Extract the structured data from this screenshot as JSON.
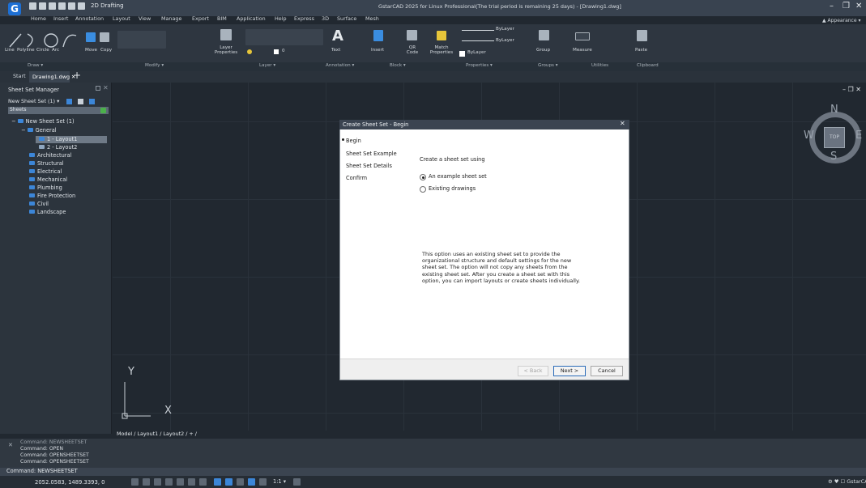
{
  "titlebar": {
    "logo": "G",
    "workspace": "2D Drafting",
    "window_title": "GstarCAD 2025 for Linux Professional(The trial period is remaining 25 days) - [Drawing1.dwg]",
    "controls": [
      "–",
      "❐",
      "✕"
    ],
    "appearance": "▲ Appearance ▾"
  },
  "menu": [
    "Home",
    "Insert",
    "Annotation",
    "Layout",
    "View",
    "Manage",
    "Export",
    "BIM",
    "Application",
    "Help",
    "Express",
    "3D",
    "Surface",
    "Mesh"
  ],
  "ribbon": {
    "tools": [
      "Line",
      "Polyline",
      "Circle",
      "Arc",
      "Move",
      "Copy",
      "Layer Properties",
      "Text",
      "Insert",
      "QR Code",
      "Match Properties",
      "Group",
      "Measure",
      "Paste"
    ],
    "layer_value": "0",
    "bylayer_1": "ByLayer",
    "bylayer_2": "ByLayer",
    "bylayer_3": "ByLayer",
    "groups": [
      "Draw ▾",
      "Modify ▾",
      "Layer ▾",
      "Annotation ▾",
      "Block ▾",
      "Properties ▾",
      "Groups ▾",
      "Utilities",
      "Clipboard"
    ]
  },
  "doc_tabs": {
    "start": "Start",
    "drawing": "Drawing1.dwg ✕",
    "add": "+"
  },
  "sheet_set_manager": {
    "title": "Sheet Set Manager",
    "combo": "New Sheet Set (1) ▾",
    "tab": "Sheets",
    "tree": {
      "root": "New Sheet Set (1)",
      "general": "General",
      "layout1": "1 - Layout1",
      "layout2": "2 - Layout2",
      "categories": [
        "Architectural",
        "Structural",
        "Electrical",
        "Mechanical",
        "Plumbing",
        "Fire Protection",
        "Civil",
        "Landscape"
      ]
    }
  },
  "model_tabs": "Model / Layout1 / Layout2 / + /",
  "viewcube": {
    "face": "TOP",
    "n": "N",
    "s": "S",
    "e": "E",
    "w": "W"
  },
  "ucs": {
    "x": "X",
    "y": "Y"
  },
  "drawing_window_controls": "– ❐ ✕",
  "dialog": {
    "title": "Create Sheet Set - Begin",
    "close": "✕",
    "steps": [
      "Begin",
      "Sheet Set Example",
      "Sheet Set Details",
      "Confirm"
    ],
    "prompt": "Create a sheet set using",
    "option_example": "An example sheet set",
    "option_existing": "Existing drawings",
    "description": "This option uses an existing sheet set to provide the organizational structure and default settings for the new sheet set.  The option will not copy any sheets from the existing sheet set.  After you create a sheet set with this option, you can import layouts or create sheets individually.",
    "back": "< Back",
    "next": "Next >",
    "cancel": "Cancel"
  },
  "command": {
    "history": [
      "Command: NEWSHEETSET",
      "Command: OPEN",
      "Command: OPENSHEETSET",
      "Command: OPENSHEETSET"
    ],
    "current": "Command: NEWSHEETSET"
  },
  "status": {
    "coords": "2052.0583, 1489.3393, 0",
    "right": "⚙ ♥ ☐ GstarCAD",
    "scale": "1:1 ▾"
  }
}
